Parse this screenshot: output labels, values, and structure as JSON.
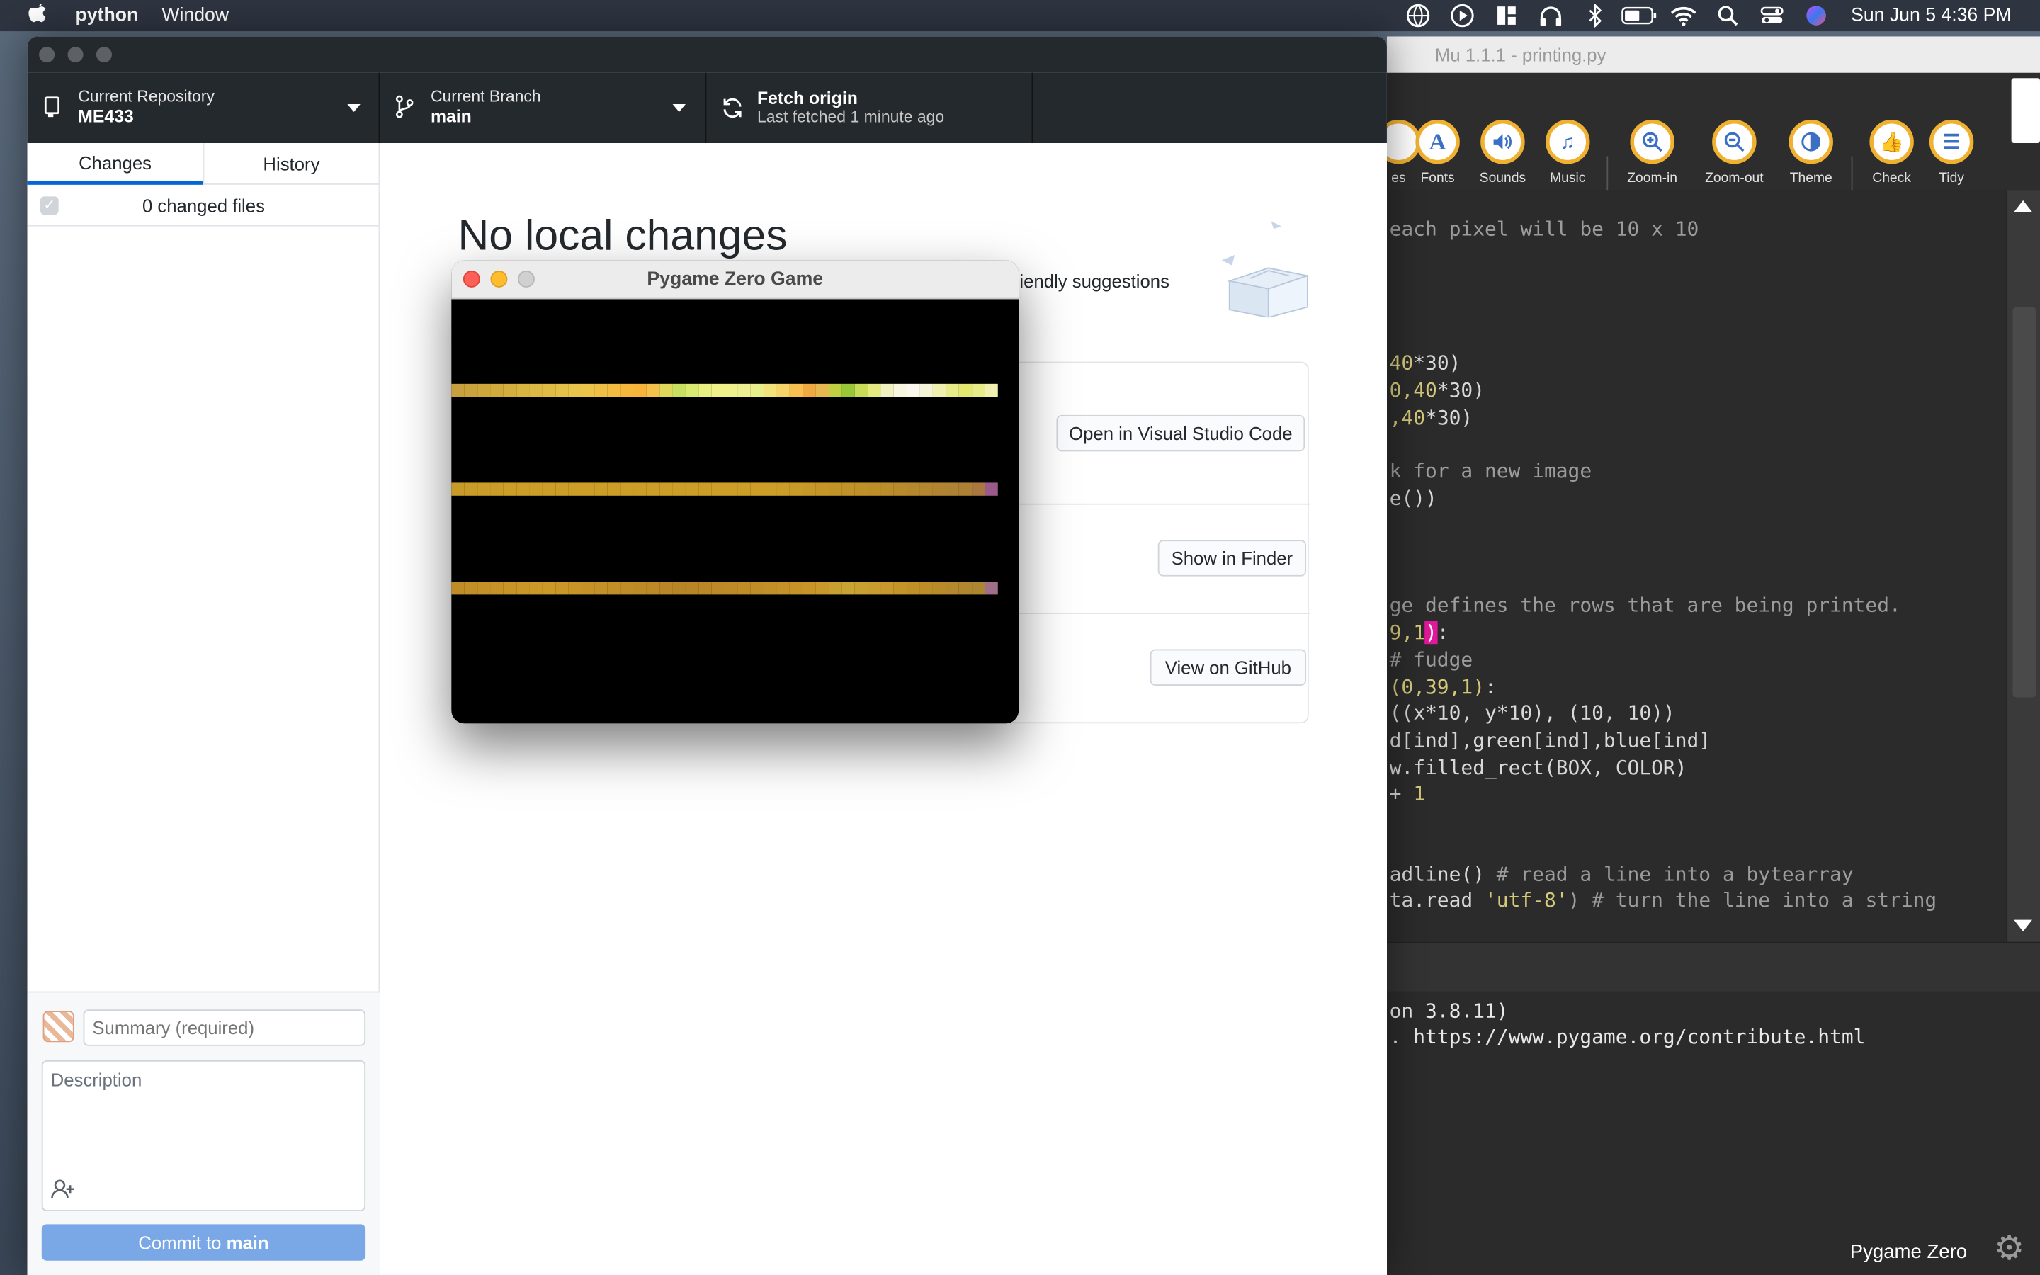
{
  "menubar": {
    "app_name": "python",
    "menu_window": "Window",
    "clock": "Sun Jun 5  4:36 PM"
  },
  "github": {
    "repo_label": "Current Repository",
    "repo_name": "ME433",
    "branch_label": "Current Branch",
    "branch_name": "main",
    "fetch_label": "Fetch origin",
    "fetch_sub": "Last fetched 1 minute ago",
    "tabs": [
      "Changes",
      "History"
    ],
    "changed_files": "0 changed files",
    "summary_placeholder": "Summary (required)",
    "description_placeholder": "Description",
    "commit_prefix": "Commit to ",
    "commit_branch": "main",
    "no_changes_title": "No local changes",
    "suggestions_fragment": "riendly suggestions",
    "buttons": {
      "open_vscode": "Open in Visual Studio Code",
      "show_finder": "Show in Finder",
      "view_github": "View on GitHub"
    }
  },
  "pygame": {
    "title": "Pygame Zero Game",
    "rows": [
      [
        "#c8a040",
        "#caa23e",
        "#cea63c",
        "#d2aa3c",
        "#d6ae3e",
        "#dab440",
        "#ddb842",
        "#e0bc44",
        "#e4c048",
        "#e8c44c",
        "#ecc44a",
        "#f0c046",
        "#f4bc40",
        "#f6b83c",
        "#f8b43a",
        "#f4c24a",
        "#e0d85a",
        "#c8e060",
        "#d8ea70",
        "#e8f080",
        "#eef288",
        "#f0f08c",
        "#ecf090",
        "#e8ee8c",
        "#f2e27a",
        "#f6d468",
        "#f8c050",
        "#f0a840",
        "#e8b850",
        "#c0d040",
        "#98c838",
        "#c8dc58",
        "#e4ea80",
        "#f0f0c0",
        "#f8f6e0",
        "#fbf8f0",
        "#f6f4d8",
        "#f0f0b0",
        "#e8ec88",
        "#e4e870",
        "#e8ec88",
        "#f0f0b0",
        "#f4e8f4",
        "#f8f0f8"
      ],
      [
        "#c89a28",
        "#c99b28",
        "#ca9c28",
        "#cb9d28",
        "#cc9e28",
        "#cc9e28",
        "#cc9e28",
        "#cc9e28",
        "#cc9e28",
        "#cc9e28",
        "#cc9e28",
        "#cc9e28",
        "#cc9e28",
        "#cc9e28",
        "#cc9e28",
        "#cc9e28",
        "#cc9e28",
        "#cc9e28",
        "#cc9e28",
        "#cc9e28",
        "#cc9e28",
        "#cc9e28",
        "#cc9e28",
        "#cc9e28",
        "#cc9e28",
        "#ca9c28",
        "#c89a28",
        "#c69828",
        "#c49628",
        "#c29428",
        "#c09228",
        "#be9028",
        "#bc8e28",
        "#ba8c2a",
        "#b88a2c",
        "#b6882e",
        "#b48630",
        "#b28432",
        "#b08234",
        "#ae8036",
        "#a87840",
        "#9a5a8a",
        "#94489c",
        "#9044a0"
      ],
      [
        "#c08c28",
        "#c28e28",
        "#c49028",
        "#c69228",
        "#c89428",
        "#ca9628",
        "#cc9828",
        "#cc9828",
        "#ca9628",
        "#c89428",
        "#c69228",
        "#c49028",
        "#c28e28",
        "#c08c28",
        "#be8a28",
        "#bc8828",
        "#ba8628",
        "#b88428",
        "#b88428",
        "#ba8628",
        "#bc8828",
        "#be8a28",
        "#c08c28",
        "#c08c28",
        "#c28e28",
        "#c49028",
        "#c69228",
        "#c89428",
        "#c8982c",
        "#c8a030",
        "#c8a432",
        "#c8a030",
        "#c89c2e",
        "#c8982c",
        "#c49428",
        "#c09028",
        "#bc8c28",
        "#b88a2a",
        "#b4882c",
        "#b0862e",
        "#ac8632",
        "#a0708a",
        "#9c6ca0",
        "#9a6aa4"
      ]
    ]
  },
  "mu": {
    "title": "Mu 1.1.1 - printing.py",
    "toolbar": [
      {
        "label": "es",
        "icon": "partial-icon"
      },
      {
        "label": "Fonts",
        "icon": "fonts-icon"
      },
      {
        "label": "Sounds",
        "icon": "sounds-icon"
      },
      {
        "label": "Music",
        "icon": "music-icon"
      },
      {
        "label": "Zoom-in",
        "icon": "zoom-in-icon"
      },
      {
        "label": "Zoom-out",
        "icon": "zoom-out-icon"
      },
      {
        "label": "Theme",
        "icon": "theme-icon"
      },
      {
        "label": "Check",
        "icon": "check-icon"
      },
      {
        "label": "Tidy",
        "icon": "tidy-icon"
      }
    ],
    "code": {
      "l1": "each pixel will be 10 x 10",
      "l2a": "40",
      "l2b": "*30)",
      "l3a": "0,40",
      "l3b": "*30)",
      "l4a": ",40",
      "l4b": "*30)",
      "l5": "k for a new image",
      "l6": "e())",
      "l7": "ge defines the rows that are being printed.",
      "l8a": "9,1",
      "l8b": ")",
      "l8c": ":",
      "l9": "# fudge",
      "l10a": "(0,39,1)",
      "l10b": ":",
      "l11": "((x*10, y*10), (10, 10))",
      "l12": "d[ind],green[ind],blue[ind]",
      "l13": "w.filled_rect(BOX, COLOR)",
      "l14a": "+ ",
      "l14b": "1",
      "l15a": "adline() ",
      "l15b": "# read a line into a bytearray",
      "l16a": "ta.read ",
      "l16b": "'utf-8'",
      "l16c": ") # turn the line into a string"
    },
    "repl": {
      "l1": "on 3.8.11)",
      "l2": ". https://www.pygame.org/contribute.html"
    },
    "mode": "Pygame Zero"
  }
}
